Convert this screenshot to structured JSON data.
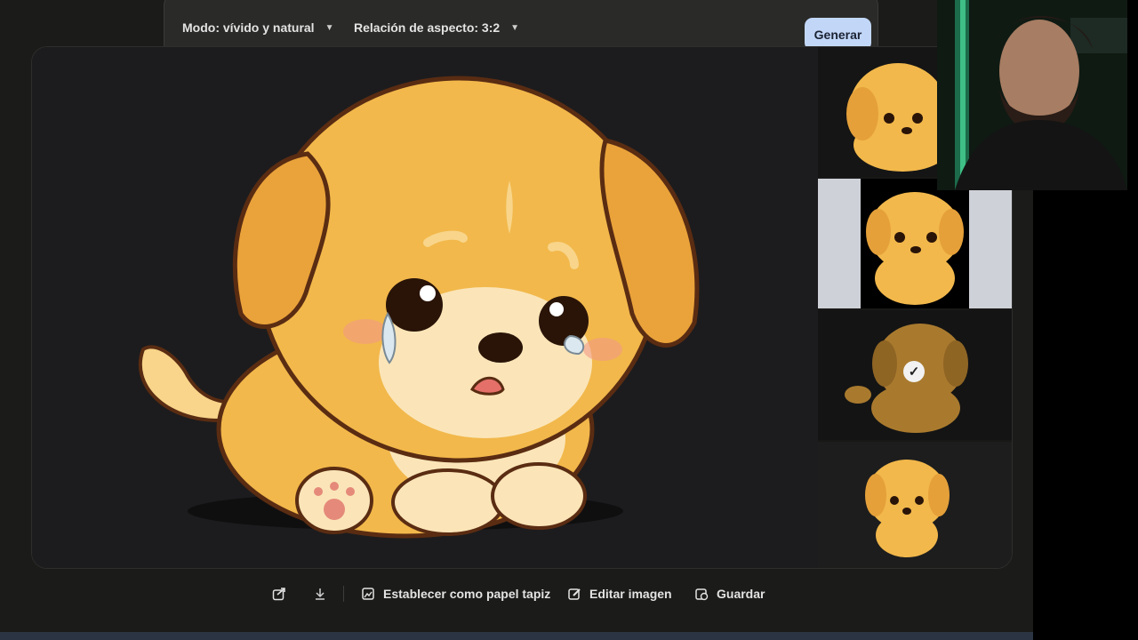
{
  "prompt_bar": {
    "mode_label": "Modo: vívido y natural",
    "aspect_label": "Relación de aspecto: 3:2",
    "generate_label": "Generar"
  },
  "thumbnails": [
    {
      "name": "variant-1",
      "selected": false
    },
    {
      "name": "variant-2",
      "selected": false
    },
    {
      "name": "variant-3",
      "selected": true
    },
    {
      "name": "variant-4",
      "selected": false
    }
  ],
  "actions": {
    "share_icon": "share-icon",
    "download_icon": "download-icon",
    "wallpaper_label": "Establecer como papel tapiz",
    "edit_label": "Editar imagen",
    "save_label": "Guardar"
  },
  "colors": {
    "page_bg": "#1b1b19",
    "panel_bg": "#2a2a28",
    "generate_button": "#c2d7f8",
    "puppy_fur": "#f2b84b"
  }
}
